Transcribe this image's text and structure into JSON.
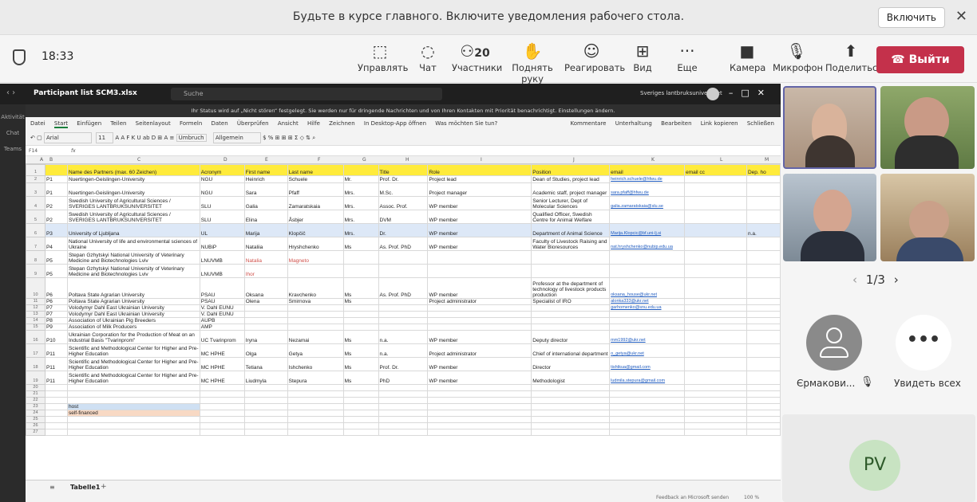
{
  "banner": {
    "message": "Будьте в курсе главного. Включите уведомления рабочего стола.",
    "enable_button": "Включить",
    "close": "✕"
  },
  "toolbar": {
    "time": "18:33",
    "participant_count": "20",
    "items": [
      {
        "label": "Управлять",
        "icon": "share-tray-icon"
      },
      {
        "label": "Чат",
        "icon": "chat-icon"
      },
      {
        "label": "Участники",
        "icon": "people-icon"
      },
      {
        "label": "Поднять руку",
        "icon": "hand-icon"
      },
      {
        "label": "Реагировать",
        "icon": "smile-icon"
      },
      {
        "label": "Вид",
        "icon": "grid-icon"
      },
      {
        "label": "Еще",
        "icon": "more-icon"
      },
      {
        "label": "Камера",
        "icon": "camera-off-icon"
      },
      {
        "label": "Микрофон",
        "icon": "mic-off-icon"
      },
      {
        "label": "Поделиться",
        "icon": "share-icon"
      }
    ],
    "leave_label": "Выйти"
  },
  "excel": {
    "filename": "Participant list SCM3.xlsx",
    "search_placeholder": "Suche",
    "org": "Sveriges lantbruksuniversitet",
    "info_bar": "Ihr Status wird auf „Nicht stören“ festgelegt. Sie werden nur für dringende Nachrichten und von Ihren Kontakten mit Priorität benachrichtigt. Einstellungen ändern.",
    "left_rail": [
      "Aktivität",
      "Chat",
      "Teams"
    ],
    "menu": [
      "Datei",
      "Start",
      "Einfügen",
      "Teilen",
      "Seitenlayout",
      "Formeln",
      "Daten",
      "Überprüfen",
      "Ansicht",
      "Hilfe",
      "Zeichnen",
      "In Desktop-App öffnen",
      "Was möchten Sie tun?",
      "Kommentare",
      "Unterhaltung",
      "Bearbeiten",
      "Link kopieren",
      "Schließen"
    ],
    "ribbon": {
      "font": "Arial",
      "size": "11",
      "wrap": "Umbruch",
      "format": "Allgemein"
    },
    "cell_ref": "F14",
    "fx": "fx",
    "col_letters": [
      "A",
      "B",
      "C",
      "D",
      "E",
      "F",
      "G",
      "H",
      "I",
      "J",
      "K",
      "L",
      "M"
    ],
    "sheet_tab": "Tabelle1",
    "add_sheet": "+",
    "feedback": "Feedback an Microsoft senden",
    "zoom": "100 %"
  },
  "sheet": {
    "header": {
      "n": "1",
      "c1": "Name des Partners (max. 60 Zeichen)",
      "c2": "Acronym",
      "c3": "First name",
      "c4": "Last name",
      "c5": "",
      "c6": "Title",
      "c7": "Role",
      "c8": "Position",
      "c9": "email",
      "c10": "email cc",
      "c11": "Dep. ho"
    },
    "rows": [
      {
        "n": "2",
        "p": "P1",
        "name": "Nuertingen-Geislingen-University",
        "acr": "NGU",
        "first": "Heinrich",
        "last": "Schuele",
        "sal": "Mr.",
        "title": "Prof. Dr.",
        "role": "Project lead",
        "pos": "Dean of Studies, project lead",
        "email": "heinrich.schuele@hfwu.de",
        "cc": "",
        "dep": ""
      },
      {
        "n": "3",
        "p": "P1",
        "name": "Nuertingen-Geislingen-University",
        "acr": "NGU",
        "first": "Sara",
        "last": "Pfaff",
        "sal": "Mrs.",
        "title": "M.Sc.",
        "role": "Project manager",
        "pos": "Academic staff, project manager",
        "email": "sara.pfaff@hfwu.de",
        "cc": "",
        "dep": ""
      },
      {
        "n": "4",
        "p": "P2",
        "name": "Swedish University of Agricultural Sciences / SVERIGES LANTBRUKSUNIVERSITET",
        "acr": "SLU",
        "first": "Galia",
        "last": "Zamaratskaia",
        "sal": "Mrs.",
        "title": "Assoc. Prof.",
        "role": "WP member",
        "pos": "Senior Lecturer, Dept of Molecular Sciences",
        "email": "galia.zamaratskaia@slu.se",
        "cc": "",
        "dep": ""
      },
      {
        "n": "5",
        "p": "P2",
        "name": "Swedish University of Agricultural Sciences / SVERIGES LANTBRUKSUNIVERSITET",
        "acr": "SLU",
        "first": "Elina",
        "last": "Åsbjer",
        "sal": "Mrs.",
        "title": "DVM",
        "role": "WP member",
        "pos": "Qualified Officer, Swedish Centre for Animal Welfare",
        "email": "",
        "cc": "",
        "dep": ""
      },
      {
        "n": "6",
        "p": "P3",
        "name": "University of Ljubljana",
        "acr": "UL",
        "first": "Marija",
        "last": "Klopčič",
        "sal": "Mrs.",
        "title": "Dr.",
        "role": "WP member",
        "pos": "Department of Animal Science",
        "email": "Marija.Klopcic@bf.uni-lj.si",
        "cc": "",
        "dep": "n.a."
      },
      {
        "n": "7",
        "p": "P4",
        "name": "National University of life and environmental sciences of Ukraine",
        "acr": "NUBiP",
        "first": "Nataliia",
        "last": "Hryshchenko",
        "sal": "Ms",
        "title": "As. Prof. PhD",
        "role": "WP member",
        "pos": "Faculty of Livestock Raising and Water Bioresources",
        "email": "nat.hryshchenko@nubip.edu.ua",
        "cc": "",
        "dep": ""
      },
      {
        "n": "8",
        "p": "P5",
        "name": "Stepan Gzhytskyi National University of Veterinary Medicine and Biotechnologies Lviv",
        "acr": "LNUVMB",
        "first": "Natalia",
        "last": "Magneto",
        "sal": "",
        "title": "",
        "role": "",
        "pos": "",
        "email": "",
        "cc": "",
        "dep": ""
      },
      {
        "n": "9",
        "p": "P5",
        "name": "Stepan Gzhytskyi National University of Veterinary Medicine and Biotechnologies Lviv",
        "acr": "LNUVMB",
        "first": "Ihor",
        "last": "",
        "sal": "",
        "title": "",
        "role": "",
        "pos": "",
        "email": "",
        "cc": "",
        "dep": ""
      },
      {
        "n": "10",
        "p": "P6",
        "name": "Poltava State Agrarian University",
        "acr": "PSAU",
        "first": "Oksana",
        "last": "Kravchenko",
        "sal": "Ms",
        "title": "As. Prof. PhD",
        "role": "WP member",
        "pos": "Professor at the department of technology of livestock products production",
        "email": "oksana_house@ukr.net",
        "cc": "",
        "dep": ""
      },
      {
        "n": "11",
        "p": "P6",
        "name": "Poltava State Agrarian University",
        "acr": "PSAU",
        "first": "Olena",
        "last": "Smirnova",
        "sal": "Ms",
        "title": "",
        "role": "Project administrator",
        "pos": "Specialist of IRO",
        "email": "alonka333@ukr.net",
        "cc": "",
        "dep": ""
      },
      {
        "n": "12",
        "p": "P7",
        "name": "Volodymyr Dahl East Ukrainian University",
        "acr": "V. Dahl EUNU",
        "first": "",
        "last": "",
        "sal": "",
        "title": "",
        "role": "",
        "pos": "",
        "email": "garhomenko@snu.edu.ua",
        "cc": "",
        "dep": ""
      },
      {
        "n": "13",
        "p": "P7",
        "name": "Volodymyr Dahl East Ukrainian University",
        "acr": "V. Dahl EUNU",
        "first": "",
        "last": "",
        "sal": "",
        "title": "",
        "role": "",
        "pos": "",
        "email": "",
        "cc": "",
        "dep": ""
      },
      {
        "n": "14",
        "p": "P8",
        "name": "Association of Ukrainian Pig Breeders",
        "acr": "AUPB",
        "first": "",
        "last": "",
        "sal": "",
        "title": "",
        "role": "",
        "pos": "",
        "email": "",
        "cc": "",
        "dep": ""
      },
      {
        "n": "15",
        "p": "P9",
        "name": "Association of Milk Producers",
        "acr": "AMP",
        "first": "",
        "last": "",
        "sal": "",
        "title": "",
        "role": "",
        "pos": "",
        "email": "",
        "cc": "",
        "dep": ""
      },
      {
        "n": "16",
        "p": "P10",
        "name": "Ukrainian Corporation for the Production of Meat on an Industrial Basis \"Tvarinprom\"",
        "acr": "UC Tvarinprom",
        "first": "Iryna",
        "last": "Nezamai",
        "sal": "Ms",
        "title": "n.a.",
        "role": "WP member",
        "pos": "Deputy director",
        "email": "mm1992@ukr.net",
        "cc": "",
        "dep": ""
      },
      {
        "n": "17",
        "p": "P11",
        "name": "Scientific and Methodological Center for Higher and Pre-Higher Education",
        "acr": "MC HPHE",
        "first": "Olga",
        "last": "Getya",
        "sal": "Ms",
        "title": "n.a.",
        "role": "Project administrator",
        "pos": "Chief of international department",
        "email": "o_getya@ukr.net",
        "cc": "",
        "dep": ""
      },
      {
        "n": "18",
        "p": "P11",
        "name": "Scientific and Methodological Center for Higher and Pre-Higher Education",
        "acr": "MC HPHE",
        "first": "Tetiana",
        "last": "Ishchenko",
        "sal": "Ms",
        "title": "Prof. Dr.",
        "role": "WP member",
        "pos": "Director",
        "email": "tishtkua@gmail.com",
        "cc": "",
        "dep": ""
      },
      {
        "n": "19",
        "p": "P11",
        "name": "Scientific and Methodological Center for Higher and Pre-Higher Education",
        "acr": "MC HPHE",
        "first": "Liudmyla",
        "last": "Stepura",
        "sal": "Ms",
        "title": "PhD",
        "role": "WP member",
        "pos": "Methodologist",
        "email": "ludmila.stepura@gmail.com",
        "cc": "",
        "dep": ""
      }
    ],
    "legend_host": "host",
    "legend_self": "self-financed",
    "empty_rows": [
      "20",
      "21",
      "22",
      "25",
      "26",
      "27"
    ],
    "legend_rows": [
      "23",
      "24"
    ]
  },
  "participants": {
    "page": "1/3",
    "prev": "‹",
    "next": "›",
    "person1_name": "Єрмакови...",
    "see_all": "Увидеть всех",
    "more": "•••",
    "pv_initials": "PV"
  }
}
